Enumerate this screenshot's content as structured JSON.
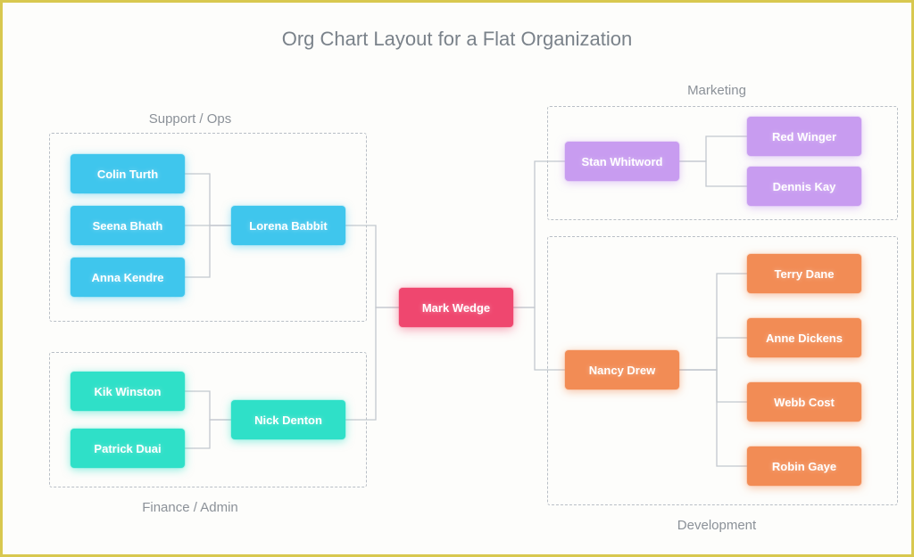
{
  "title": "Org Chart Layout for a Flat Organization",
  "departments": {
    "support_ops": "Support / Ops",
    "finance_admin": "Finance / Admin",
    "marketing": "Marketing",
    "development": "Development"
  },
  "center": {
    "name": "Mark Wedge"
  },
  "support_ops": {
    "lead": "Lorena Babbit",
    "members": [
      "Colin Turth",
      "Seena Bhath",
      "Anna Kendre"
    ]
  },
  "finance_admin": {
    "lead": "Nick Denton",
    "members": [
      "Kik Winston",
      "Patrick Duai"
    ]
  },
  "marketing": {
    "lead": "Stan Whitword",
    "members": [
      "Red Winger",
      "Dennis Kay"
    ]
  },
  "development": {
    "lead": "Nancy Drew",
    "members": [
      "Terry Dane",
      "Anne Dickens",
      "Webb Cost",
      "Robin Gaye"
    ]
  },
  "chart_data": {
    "type": "org",
    "root": "Mark Wedge",
    "branches": [
      {
        "department": "Support / Ops",
        "lead": "Lorena Babbit",
        "members": [
          "Colin Turth",
          "Seena Bhath",
          "Anna Kendre"
        ]
      },
      {
        "department": "Finance / Admin",
        "lead": "Nick Denton",
        "members": [
          "Kik Winston",
          "Patrick Duai"
        ]
      },
      {
        "department": "Marketing",
        "lead": "Stan Whitword",
        "members": [
          "Red Winger",
          "Dennis Kay"
        ]
      },
      {
        "department": "Development",
        "lead": "Nancy Drew",
        "members": [
          "Terry Dane",
          "Anne Dickens",
          "Webb Cost",
          "Robin Gaye"
        ]
      }
    ]
  }
}
